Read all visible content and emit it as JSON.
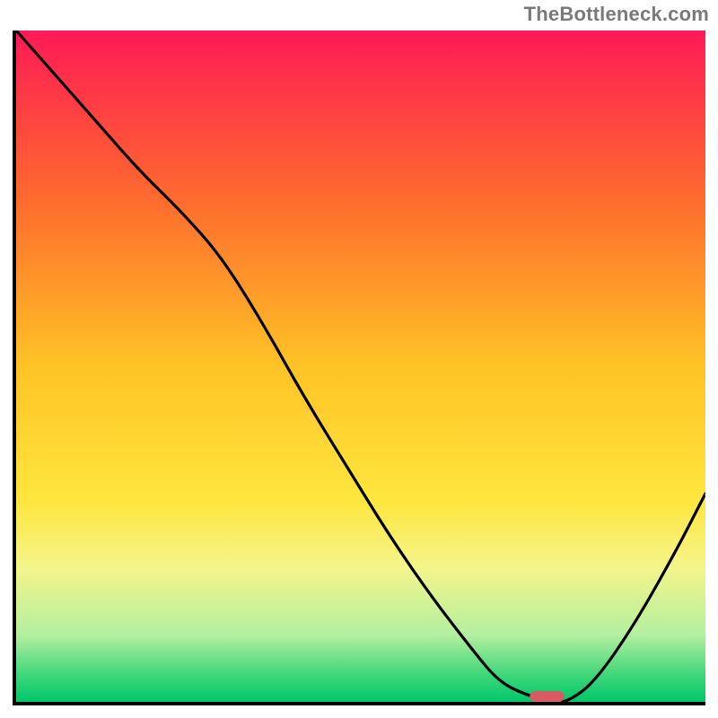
{
  "watermark": "TheBottleneck.com",
  "chart_data": {
    "type": "line",
    "title": "",
    "xlabel": "",
    "ylabel": "",
    "xlim": [
      0,
      100
    ],
    "ylim": [
      0,
      100
    ],
    "background_gradient": {
      "stops": [
        {
          "offset": 0,
          "color": "#ff1a56"
        },
        {
          "offset": 25,
          "color": "#ff6a2e"
        },
        {
          "offset": 50,
          "color": "#ffc326"
        },
        {
          "offset": 70,
          "color": "#ffe63e"
        },
        {
          "offset": 80,
          "color": "#f4f58a"
        },
        {
          "offset": 90,
          "color": "#b4efa0"
        },
        {
          "offset": 96,
          "color": "#3ed77a"
        },
        {
          "offset": 100,
          "color": "#00c76a"
        }
      ]
    },
    "series": [
      {
        "name": "bottleneck-curve",
        "x": [
          0,
          6,
          12,
          18,
          24,
          30,
          36,
          42,
          48,
          54,
          60,
          66,
          70,
          74,
          78,
          80,
          84,
          90,
          96,
          100
        ],
        "y": [
          100,
          93,
          86,
          79,
          73,
          66,
          56,
          45,
          35,
          25,
          16,
          8,
          3,
          1,
          0,
          0,
          3,
          12,
          23,
          31
        ]
      }
    ],
    "marker": {
      "name": "optimal-point",
      "x": 77,
      "y": 0,
      "width_pct": 5,
      "height_pct": 1.6,
      "color": "#d85a62"
    }
  }
}
